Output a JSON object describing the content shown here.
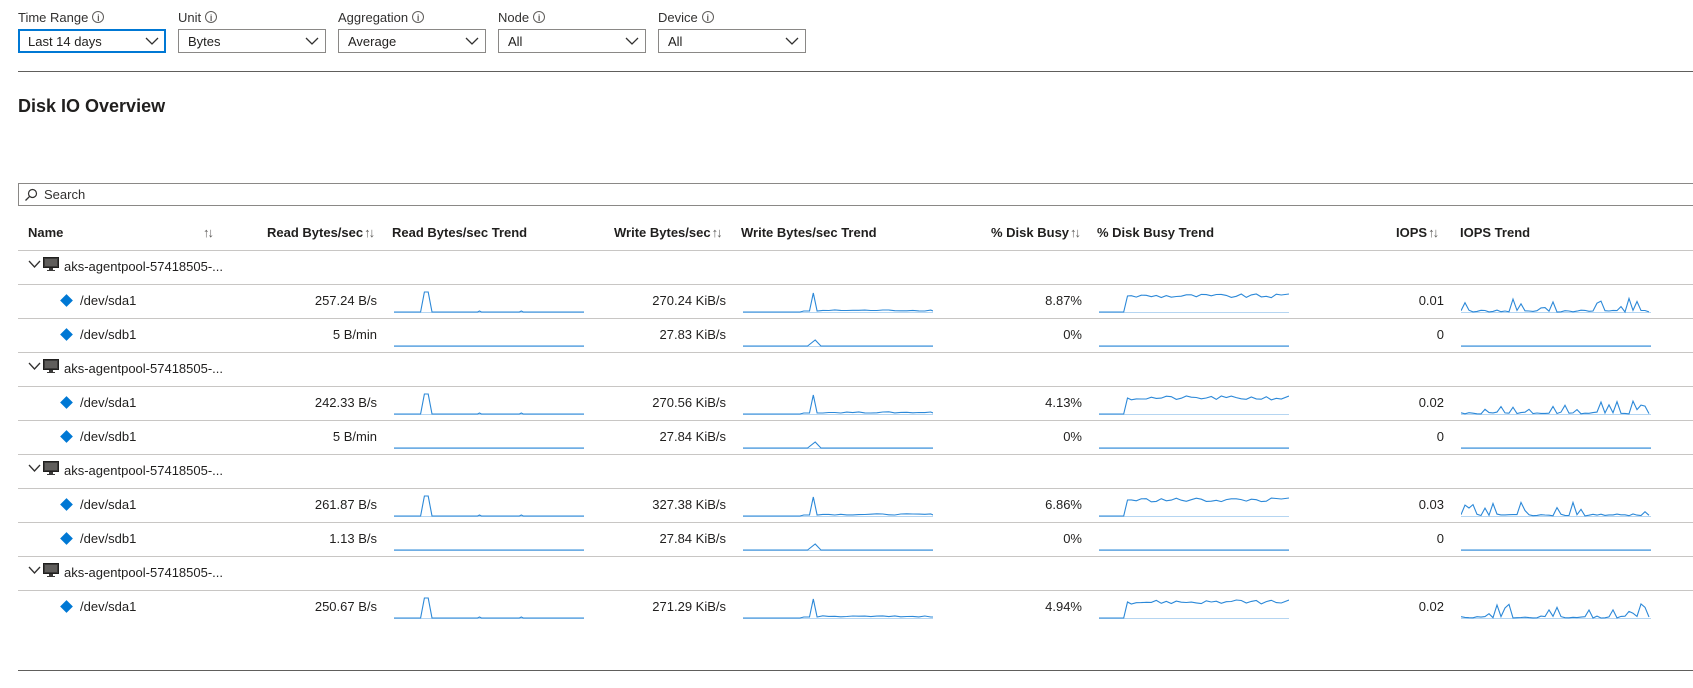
{
  "filters": [
    {
      "label": "Time Range",
      "value": "Last 14 days",
      "focused": true
    },
    {
      "label": "Unit",
      "value": "Bytes",
      "focused": false
    },
    {
      "label": "Aggregation",
      "value": "Average",
      "focused": false
    },
    {
      "label": "Node",
      "value": "All",
      "focused": false
    },
    {
      "label": "Device",
      "value": "All",
      "focused": false
    }
  ],
  "info_icon": "info-icon",
  "section_title": "Disk IO Overview",
  "search": {
    "placeholder": "Search"
  },
  "columns": {
    "name": "Name",
    "read": "Read Bytes/sec",
    "read_trend": "Read Bytes/sec Trend",
    "write": "Write Bytes/sec",
    "write_trend": "Write Bytes/sec Trend",
    "busy": "% Disk Busy",
    "busy_trend": "% Disk Busy Trend",
    "iops": "IOPS",
    "iops_trend": "IOPS Trend",
    "sort_glyph": "↑↓"
  },
  "colors": {
    "accent": "#0078d4",
    "spark": "#2b88d8"
  },
  "groups": [
    {
      "node": "aks-agentpool-57418505-...",
      "devices": [
        {
          "name": "/dev/sda1",
          "read": "257.24 B/s",
          "write": "270.24 KiB/s",
          "busy": "8.87%",
          "iops": "0.01",
          "trend": "active"
        },
        {
          "name": "/dev/sdb1",
          "read": "5 B/min",
          "write": "27.83 KiB/s",
          "busy": "0%",
          "iops": "0",
          "trend": "idle"
        }
      ]
    },
    {
      "node": "aks-agentpool-57418505-...",
      "devices": [
        {
          "name": "/dev/sda1",
          "read": "242.33 B/s",
          "write": "270.56 KiB/s",
          "busy": "4.13%",
          "iops": "0.02",
          "trend": "active"
        },
        {
          "name": "/dev/sdb1",
          "read": "5 B/min",
          "write": "27.84 KiB/s",
          "busy": "0%",
          "iops": "0",
          "trend": "idle"
        }
      ]
    },
    {
      "node": "aks-agentpool-57418505-...",
      "devices": [
        {
          "name": "/dev/sda1",
          "read": "261.87 B/s",
          "write": "327.38 KiB/s",
          "busy": "6.86%",
          "iops": "0.03",
          "trend": "active"
        },
        {
          "name": "/dev/sdb1",
          "read": "1.13 B/s",
          "write": "27.84 KiB/s",
          "busy": "0%",
          "iops": "0",
          "trend": "idle"
        }
      ]
    },
    {
      "node": "aks-agentpool-57418505-...",
      "devices": [
        {
          "name": "/dev/sda1",
          "read": "250.67 B/s",
          "write": "271.29 KiB/s",
          "busy": "4.94%",
          "iops": "0.02",
          "trend": "active"
        }
      ]
    }
  ]
}
